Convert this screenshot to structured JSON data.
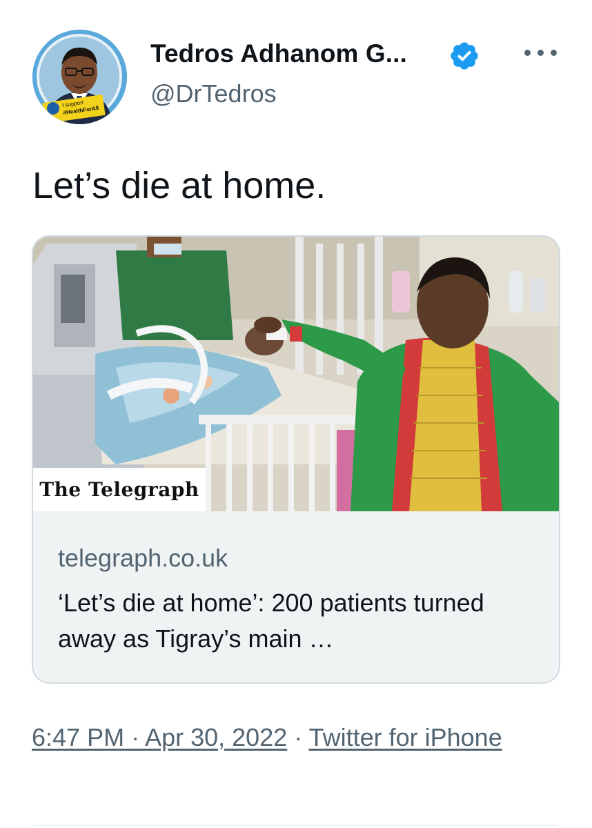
{
  "author": {
    "display_name": "Tedros Adhanom G...",
    "handle": "@DrTedros",
    "avatar_icon": "profile-photo",
    "avatar_banner_line1": "I support",
    "avatar_banner_line2": "#HealthForAll",
    "verified_icon": "verified-badge-icon"
  },
  "more_icon": "more-options-icon",
  "tweet": {
    "text": "Let’s die at home."
  },
  "card": {
    "image_icon": "article-photo",
    "publisher": "The Telegraph",
    "domain": "telegraph.co.uk",
    "title": "‘Let’s die at home’: 200 patients turned away as Tigray’s main …"
  },
  "meta": {
    "time": "6:47 PM",
    "date": "Apr 30, 2022",
    "separator": " · ",
    "source": "Twitter for iPhone"
  },
  "colors": {
    "verified": "#1d9bf0",
    "secondary_text": "#536471",
    "card_meta_bg": "#eff3f4",
    "border": "#cfd9de"
  }
}
